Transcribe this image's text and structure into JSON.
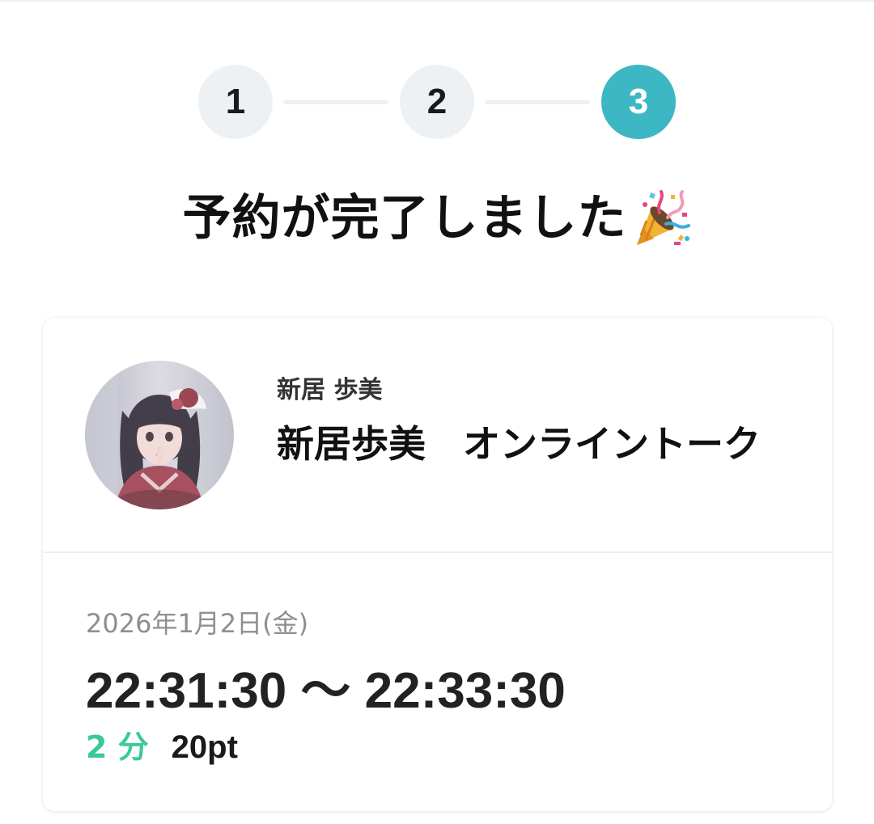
{
  "stepper": {
    "steps": [
      {
        "label": "1",
        "state": "done"
      },
      {
        "label": "2",
        "state": "done"
      },
      {
        "label": "3",
        "state": "current"
      }
    ],
    "active_color": "#3db7c3",
    "inactive_color": "#edf1f4"
  },
  "title": {
    "text": "予約が完了しました",
    "icon": "party-popper-icon"
  },
  "booking": {
    "performer_name": "新居 歩美",
    "event_title": "新居歩美　オンライントーク",
    "avatar": "performer-avatar-photo",
    "date": "2026年1月2日(金)",
    "time_range": "22:31:30 〜 22:33:30",
    "duration": "2 分",
    "price": "20pt",
    "duration_color": "#3cc89a"
  }
}
